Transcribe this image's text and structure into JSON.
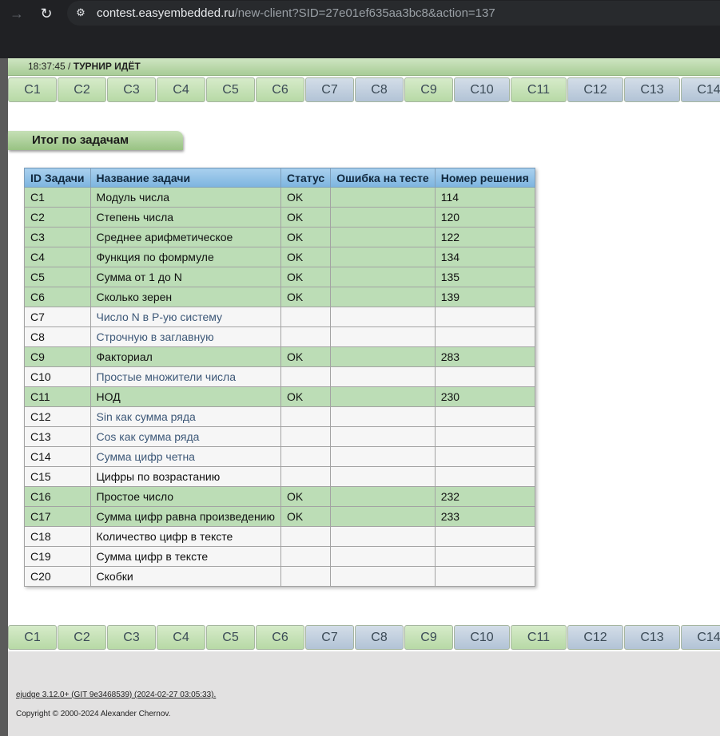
{
  "browser": {
    "url_host": "contest.easyembedded.ru",
    "url_path": "/new-client?SID=27e01ef635aa3bc8&action=137"
  },
  "status": {
    "time": "18:37:45",
    "separator": " / ",
    "state": "ТУРНИР ИДЁТ"
  },
  "tabs": [
    {
      "label": "C1",
      "solved": true
    },
    {
      "label": "C2",
      "solved": true
    },
    {
      "label": "C3",
      "solved": true
    },
    {
      "label": "C4",
      "solved": true
    },
    {
      "label": "C5",
      "solved": true
    },
    {
      "label": "C6",
      "solved": true
    },
    {
      "label": "C7",
      "solved": false
    },
    {
      "label": "C8",
      "solved": false
    },
    {
      "label": "C9",
      "solved": true
    },
    {
      "label": "C10",
      "solved": false
    },
    {
      "label": "C11",
      "solved": true
    },
    {
      "label": "C12",
      "solved": false
    },
    {
      "label": "C13",
      "solved": false
    },
    {
      "label": "C14",
      "solved": false
    }
  ],
  "section_title": "Итог по задачам",
  "table": {
    "headers": [
      "ID Задачи",
      "Название задачи",
      "Статус",
      "Ошибка на тесте",
      "Номер решения"
    ],
    "rows": [
      {
        "id": "C1",
        "name": "Модуль числа",
        "status": "OK",
        "failed_test": "",
        "run": "114",
        "solved": true
      },
      {
        "id": "C2",
        "name": "Степень числа",
        "status": "OK",
        "failed_test": "",
        "run": "120",
        "solved": true
      },
      {
        "id": "C3",
        "name": "Среднее арифметическое",
        "status": "OK",
        "failed_test": "",
        "run": "122",
        "solved": true
      },
      {
        "id": "C4",
        "name": "Функция по фомрмуле",
        "status": "OK",
        "failed_test": "",
        "run": "134",
        "solved": true
      },
      {
        "id": "C5",
        "name": "Сумма от 1 до N",
        "status": "OK",
        "failed_test": "",
        "run": "135",
        "solved": true
      },
      {
        "id": "C6",
        "name": "Сколько зерен",
        "status": "OK",
        "failed_test": "",
        "run": "139",
        "solved": true
      },
      {
        "id": "C7",
        "name": "Число N в P-ую систему",
        "status": "",
        "failed_test": "",
        "run": "",
        "solved": false,
        "link": true
      },
      {
        "id": "C8",
        "name": "Строчную в заглавную",
        "status": "",
        "failed_test": "",
        "run": "",
        "solved": false,
        "link": true
      },
      {
        "id": "C9",
        "name": "Факториал",
        "status": "OK",
        "failed_test": "",
        "run": "283",
        "solved": true,
        "link": true
      },
      {
        "id": "C10",
        "name": "Простые множители числа",
        "status": "",
        "failed_test": "",
        "run": "",
        "solved": false,
        "link": true
      },
      {
        "id": "C11",
        "name": "НОД",
        "status": "OK",
        "failed_test": "",
        "run": "230",
        "solved": true
      },
      {
        "id": "C12",
        "name": "Sin как сумма ряда",
        "status": "",
        "failed_test": "",
        "run": "",
        "solved": false,
        "link": true
      },
      {
        "id": "C13",
        "name": "Cos как сумма ряда",
        "status": "",
        "failed_test": "",
        "run": "",
        "solved": false,
        "link": true
      },
      {
        "id": "C14",
        "name": "Сумма цифр четна",
        "status": "",
        "failed_test": "",
        "run": "",
        "solved": false,
        "link": true
      },
      {
        "id": "C15",
        "name": "Цифры по возрастанию",
        "status": "",
        "failed_test": "",
        "run": "",
        "solved": false,
        "link": false
      },
      {
        "id": "C16",
        "name": "Простое число",
        "status": "OK",
        "failed_test": "",
        "run": "232",
        "solved": true
      },
      {
        "id": "C17",
        "name": "Сумма цифр равна произведению",
        "status": "OK",
        "failed_test": "",
        "run": "233",
        "solved": true
      },
      {
        "id": "C18",
        "name": "Количество цифр в тексте",
        "status": "",
        "failed_test": "",
        "run": "",
        "solved": false,
        "link": false
      },
      {
        "id": "C19",
        "name": "Сумма цифр в тексте",
        "status": "",
        "failed_test": "",
        "run": "",
        "solved": false,
        "link": false
      },
      {
        "id": "C20",
        "name": "Скобки",
        "status": "",
        "failed_test": "",
        "run": "",
        "solved": false,
        "link": false
      }
    ]
  },
  "footer": {
    "version": "ejudge 3.12.0+ (GIT 9e3468539) (2024-02-27 03:05:33).",
    "copyright": "Copyright © 2000-2024 Alexander Chernov."
  }
}
